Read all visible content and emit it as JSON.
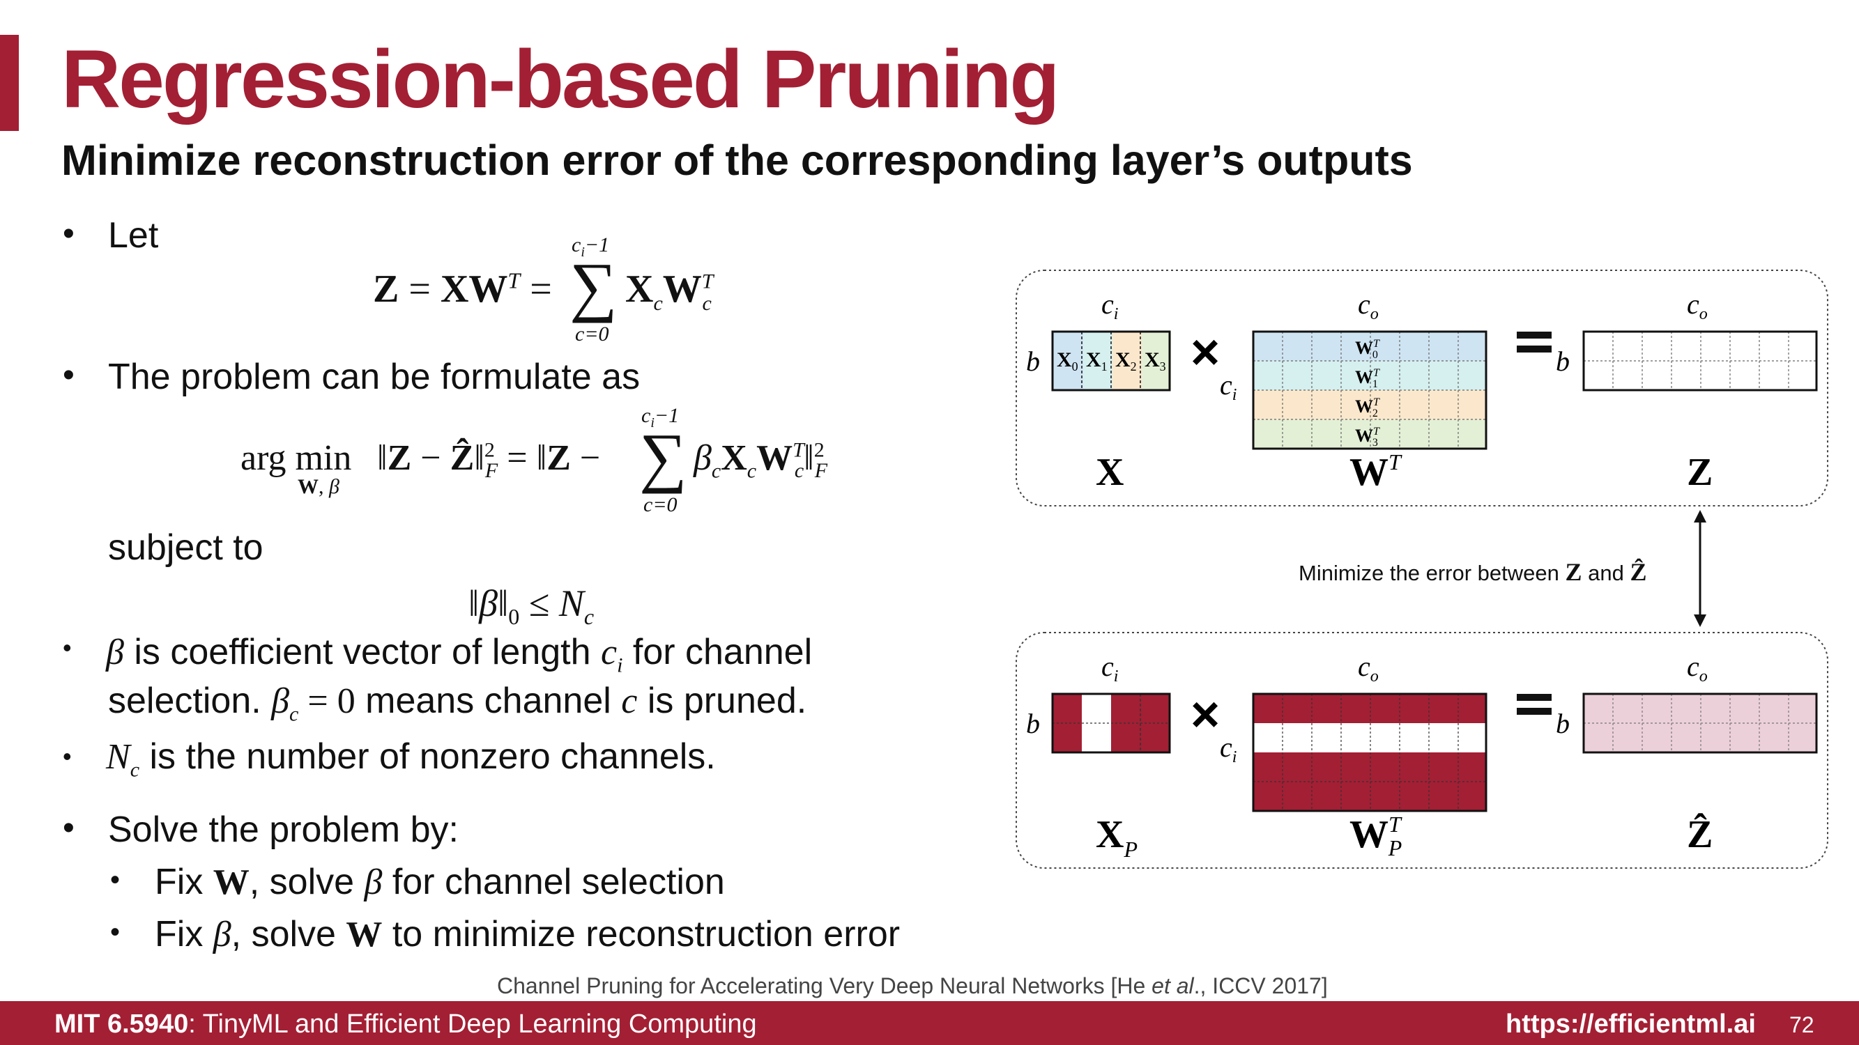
{
  "slide": {
    "title": "Regression-based Pruning",
    "subtitle": "Minimize reconstruction error of the corresponding layer’s outputs"
  },
  "bullets": {
    "let": "Let",
    "problem": "The problem can be formulate as",
    "subject_to": "subject to",
    "beta_line1_a": " is coefficient vector of length ",
    "beta_line1_b": " for channel",
    "beta_line2_a": "selection. ",
    "beta_line2_b": " means channel ",
    "beta_line2_c": " is pruned.",
    "nc_text": " is the number of nonzero channels.",
    "solve": "Solve the problem by:",
    "fix_w_a": "Fix ",
    "fix_w_b": ", solve ",
    "fix_w_c": " for channel selection",
    "fix_b_a": "Fix ",
    "fix_b_b": ", solve ",
    "fix_b_c": " to minimize reconstruction error"
  },
  "diagram": {
    "caption": "Minimize the error between",
    "caption_and": "and",
    "colors": {
      "accent": "#a31f34",
      "row_blue": "#cfe4f2",
      "row_cyan": "#d6efef",
      "row_orange": "#fbe8cc",
      "row_green": "#e4f0d6",
      "z_hat_fill": "#ecd0d9"
    }
  },
  "citation": {
    "prefix": "Channel Pruning for Accelerating Very Deep Neural Networks [He ",
    "etal": "et al",
    "suffix": "., ICCV 2017]"
  },
  "footer": {
    "course_bold": "MIT 6.5940",
    "course_rest": ": TinyML and Efficient Deep Learning Computing",
    "url": "https://efficientml.ai",
    "page": "72"
  }
}
